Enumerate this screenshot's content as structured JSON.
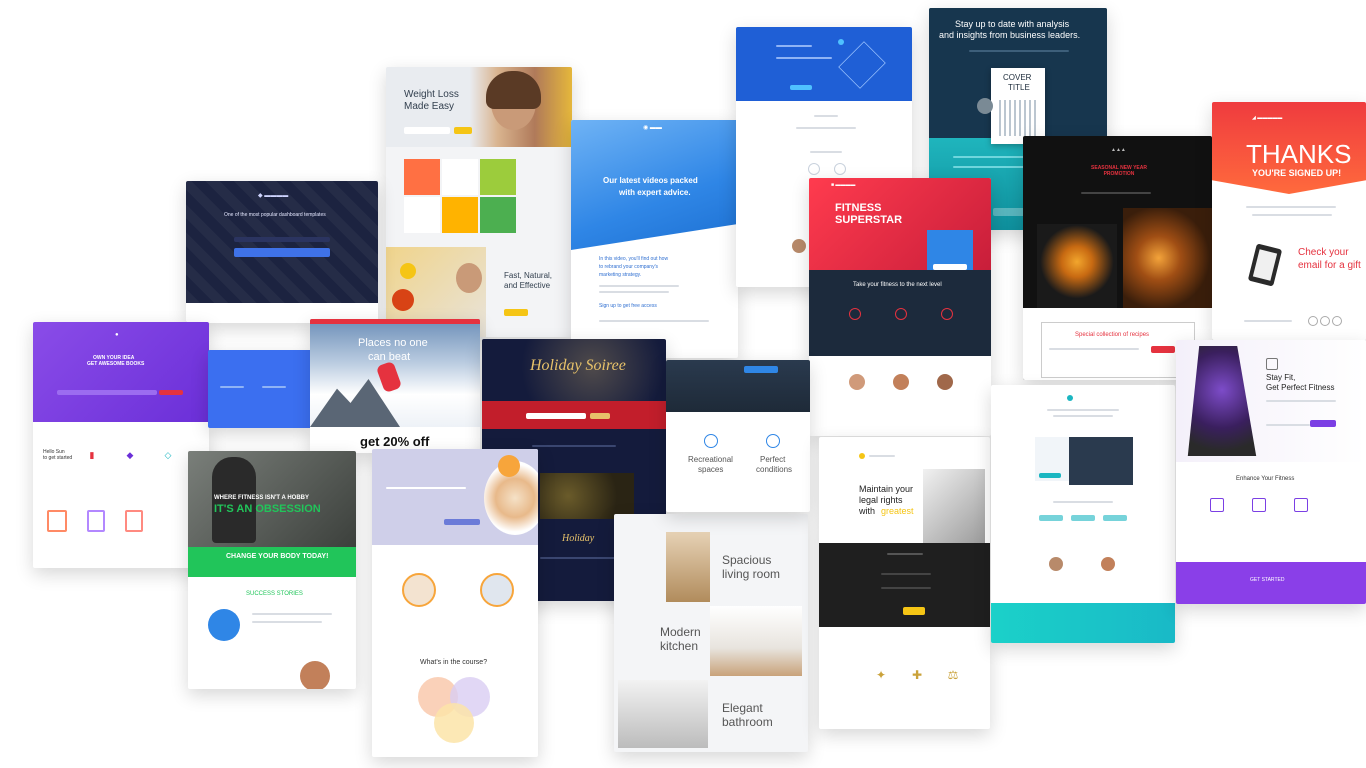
{
  "weightloss": {
    "title_line1": "Weight Loss",
    "title_line2": "Made Easy",
    "hero_sub": "Fast, Natural,",
    "hero_sub2": "and Effective"
  },
  "dark_signup": {
    "headline": "One of the most popular dashboard templates"
  },
  "videos": {
    "headline_line1": "Our latest videos packed",
    "headline_line2": "with expert advice.",
    "body_line1": "In this video, you'll find out how",
    "body_line2": "to rebrand your company's",
    "body_line3": "marketing strategy.",
    "cta": "Sign up to get free access"
  },
  "analysis": {
    "headline_line1": "Stay up to date with analysis",
    "headline_line2": "and insights from business leaders.",
    "cover_line1": "COVER",
    "cover_line2": "TITLE"
  },
  "thanks": {
    "title": "THANKS",
    "subtitle": "YOU'RE SIGNED UP!",
    "check_line1": "Check your",
    "check_line2": "email for a gift"
  },
  "fitness": {
    "title_line1": "FITNESS",
    "title_line2": "SUPERSTAR",
    "tagline": "Take your fitness to the next level"
  },
  "purple_ebook": {
    "headline_line1": "OWN YOUR IDEA",
    "headline_line2": "GET AWESOME BOOKS",
    "side_line1": "Hello Sun",
    "side_line2": "to get started"
  },
  "ski": {
    "line1": "Places no one",
    "line2": "can beat",
    "discount": "get 20% off"
  },
  "holiday": {
    "script_title": "Holiday Soiree",
    "script_footer": "Holiday"
  },
  "obsession": {
    "line1": "WHERE FITNESS ISN'T A HOBBY",
    "line2": "IT'S AN OBSESSION",
    "cta": "CHANGE YOUR BODY TODAY!",
    "section": "SUCCESS STORIES"
  },
  "course": {
    "title": "What's in the course?"
  },
  "pumpkin": {
    "headline": "SEASONAL NEW YEAR PROMOTION",
    "signup": "Special collection of recipes"
  },
  "fitgirl": {
    "title_line1": "Stay Fit,",
    "title_line2": "Get Perfect Fitness",
    "section": "Enhance Your Fitness",
    "banner": "GET STARTED"
  },
  "legal": {
    "line1": "Maintain your",
    "line2": "legal rights",
    "line3": "with",
    "highlight": "greatest"
  },
  "rooms": {
    "spacious_1": "Spacious",
    "spacious_2": "living room",
    "modern_1": "Modern",
    "modern_2": "kitchen",
    "elegant_1": "Elegant",
    "elegant_2": "bathroom"
  },
  "recreation": {
    "item1_line1": "Recreational",
    "item1_line2": "spaces",
    "item2_line1": "Perfect",
    "item2_line2": "conditions"
  },
  "colors": {
    "purple": "#7b3fe4",
    "red": "#e5323f",
    "navy": "#1c1f3f",
    "blue": "#2f86e6",
    "teal": "#1bb6c1",
    "yellow": "#f5c515",
    "green": "#21c55a",
    "orange": "#ff6a3d"
  },
  "icons": [
    "pencil-icon",
    "tablet-icon",
    "clipboard-icon",
    "dumbbell-icon",
    "clock-icon",
    "lightbulb-icon",
    "key-icon",
    "check-icon",
    "home-icon",
    "calendar-icon"
  ]
}
